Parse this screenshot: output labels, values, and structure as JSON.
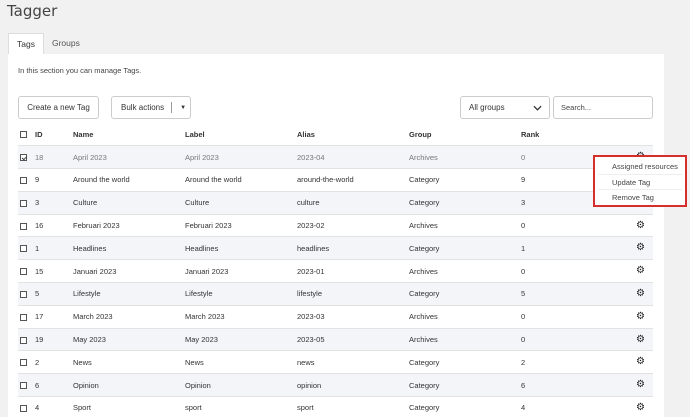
{
  "page": {
    "title": "Tagger"
  },
  "tabs": [
    {
      "label": "Tags",
      "active": true
    },
    {
      "label": "Groups",
      "active": false
    }
  ],
  "intro": "In this section you can manage Tags.",
  "toolbar": {
    "create_label": "Create a new Tag",
    "bulk_label": "Bulk actions",
    "group_filter": "All groups",
    "search_placeholder": "Search..."
  },
  "table": {
    "columns": [
      "ID",
      "Name",
      "Label",
      "Alias",
      "Group",
      "Rank"
    ],
    "rows": [
      {
        "checked": true,
        "id": "18",
        "name": "April 2023",
        "label": "April 2023",
        "alias": "2023-04",
        "group": "Archives",
        "rank": "0"
      },
      {
        "checked": false,
        "id": "9",
        "name": "Around the world",
        "label": "Around the world",
        "alias": "around-the-world",
        "group": "Category",
        "rank": "9"
      },
      {
        "checked": false,
        "id": "3",
        "name": "Culture",
        "label": "Culture",
        "alias": "culture",
        "group": "Category",
        "rank": "3"
      },
      {
        "checked": false,
        "id": "16",
        "name": "Februari 2023",
        "label": "Februari 2023",
        "alias": "2023-02",
        "group": "Archives",
        "rank": "0"
      },
      {
        "checked": false,
        "id": "1",
        "name": "Headlines",
        "label": "Headlines",
        "alias": "headlines",
        "group": "Category",
        "rank": "1"
      },
      {
        "checked": false,
        "id": "15",
        "name": "Januari 2023",
        "label": "Januari 2023",
        "alias": "2023-01",
        "group": "Archives",
        "rank": "0"
      },
      {
        "checked": false,
        "id": "5",
        "name": "Lifestyle",
        "label": "Lifestyle",
        "alias": "lifestyle",
        "group": "Category",
        "rank": "5"
      },
      {
        "checked": false,
        "id": "17",
        "name": "March 2023",
        "label": "March 2023",
        "alias": "2023-03",
        "group": "Archives",
        "rank": "0"
      },
      {
        "checked": false,
        "id": "19",
        "name": "May 2023",
        "label": "May 2023",
        "alias": "2023-05",
        "group": "Archives",
        "rank": "0"
      },
      {
        "checked": false,
        "id": "2",
        "name": "News",
        "label": "News",
        "alias": "news",
        "group": "Category",
        "rank": "2"
      },
      {
        "checked": false,
        "id": "6",
        "name": "Opinion",
        "label": "Opinion",
        "alias": "opinion",
        "group": "Category",
        "rank": "6"
      },
      {
        "checked": false,
        "id": "4",
        "name": "Sport",
        "label": "sport",
        "alias": "sport",
        "group": "Category",
        "rank": "4"
      }
    ]
  },
  "context_menu": {
    "items": [
      "Assigned resources",
      "Update Tag",
      "Remove Tag"
    ],
    "highlight_color": "#d62d2d"
  },
  "icons": {
    "row_action": "gear-icon",
    "dropdown": "chevron-down-icon",
    "bulk_caret": "caret-down-icon"
  }
}
